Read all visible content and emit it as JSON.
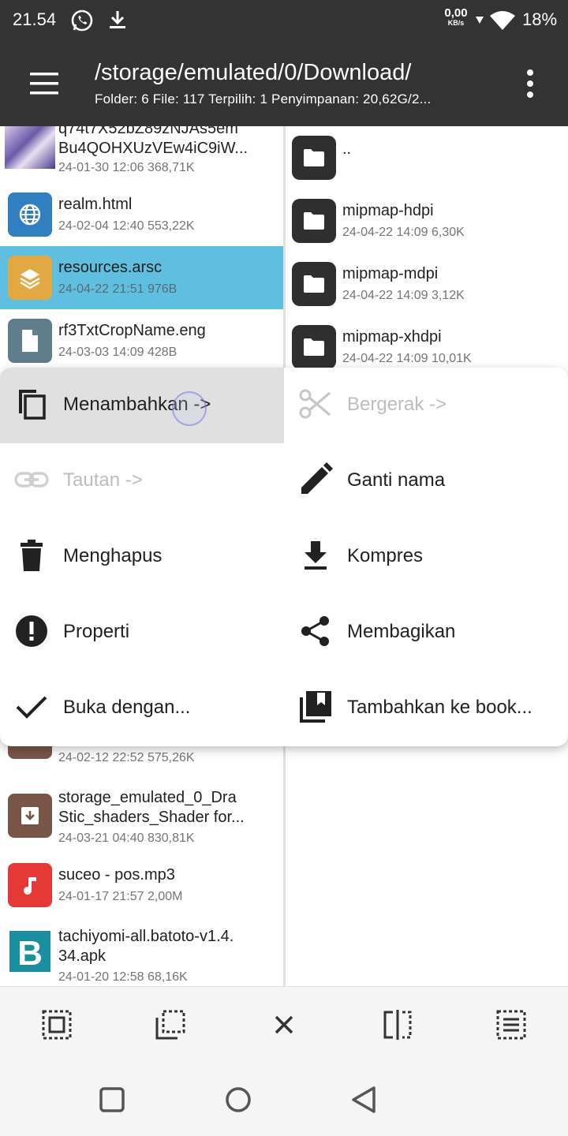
{
  "status_bar": {
    "time": "21.54",
    "net_speed": "0,00",
    "net_unit": "KB/s",
    "battery": "18%"
  },
  "app_bar": {
    "path": "/storage/emulated/0/Download/",
    "info": "Folder: 6  File: 117  Terpilih: 1  Penyimpanan: 20,62G/2..."
  },
  "left_files": [
    {
      "name_line1": "q74t7X52bZ89zNJAs5em",
      "name_line2": "Bu4QOHXUzVEw4iC9iW...",
      "meta": "24-01-30 12:06  368,71K",
      "icon": "image-thumbnail"
    },
    {
      "name": "realm.html",
      "meta": "24-02-04 12:40  553,22K",
      "icon": "globe-icon",
      "color": "#2f7fc1"
    },
    {
      "name": "resources.arsc",
      "meta": "24-04-22 21:51  976B",
      "icon": "layers-icon",
      "color": "#e2a942",
      "selected": true
    },
    {
      "name": "rf3TxtCropName.eng",
      "meta": "24-03-03 14:09  428B",
      "icon": "document-icon",
      "color": "#607d8b"
    },
    {
      "meta": "24-02-12 22:52  575,26K",
      "icon": "archive-icon",
      "color": "#795548"
    },
    {
      "name_line1": "storage_emulated_0_Dra",
      "name_line2": "Stic_shaders_Shader for...",
      "meta": "24-03-21 04:40  830,81K",
      "icon": "archive-icon",
      "color": "#795548"
    },
    {
      "name": "suceo - pos.mp3",
      "meta": "24-01-17 21:57  2,00M",
      "icon": "music-note-icon",
      "color": "#e53935"
    },
    {
      "name_line1": "tachiyomi-all.batoto-v1.4.",
      "name_line2": "34.apk",
      "meta": "24-01-20 12:58  68,16K",
      "icon": "app-b-icon",
      "color": "#1a8fa0"
    }
  ],
  "right_files": [
    {
      "name": "..",
      "meta": ""
    },
    {
      "name": "mipmap-hdpi",
      "meta": "24-04-22 14:09  6,30K"
    },
    {
      "name": "mipmap-mdpi",
      "meta": "24-04-22 14:09  3,12K"
    },
    {
      "name": "mipmap-xhdpi",
      "meta": "24-04-22 14:09  10,01K"
    }
  ],
  "popup_menu": [
    {
      "label": "Menambahkan ->",
      "icon": "copy-icon",
      "enabled": true,
      "pressed": true
    },
    {
      "label": "Bergerak ->",
      "icon": "scissors-icon",
      "enabled": false
    },
    {
      "label": "Tautan ->",
      "icon": "link-icon",
      "enabled": false
    },
    {
      "label": "Ganti nama",
      "icon": "pencil-icon",
      "enabled": true
    },
    {
      "label": "Menghapus",
      "icon": "trash-icon",
      "enabled": true
    },
    {
      "label": "Kompres",
      "icon": "download-icon",
      "enabled": true
    },
    {
      "label": "Properti",
      "icon": "info-alert-icon",
      "enabled": true
    },
    {
      "label": "Membagikan",
      "icon": "share-icon",
      "enabled": true
    },
    {
      "label": "Buka dengan...",
      "icon": "check-icon",
      "enabled": true
    },
    {
      "label": "Tambahkan ke book...",
      "icon": "bookmark-library-icon",
      "enabled": true
    }
  ],
  "bottom_toolbar": [
    "select-all-icon",
    "select-range-icon",
    "close-icon",
    "invert-selection-icon",
    "select-list-icon"
  ],
  "nav_bar": [
    "recents-icon",
    "home-icon",
    "back-icon"
  ],
  "colors": {
    "app_bar": "#333333",
    "selected_row": "#5fbfe0",
    "folder_icon": "#2f2f2f"
  }
}
